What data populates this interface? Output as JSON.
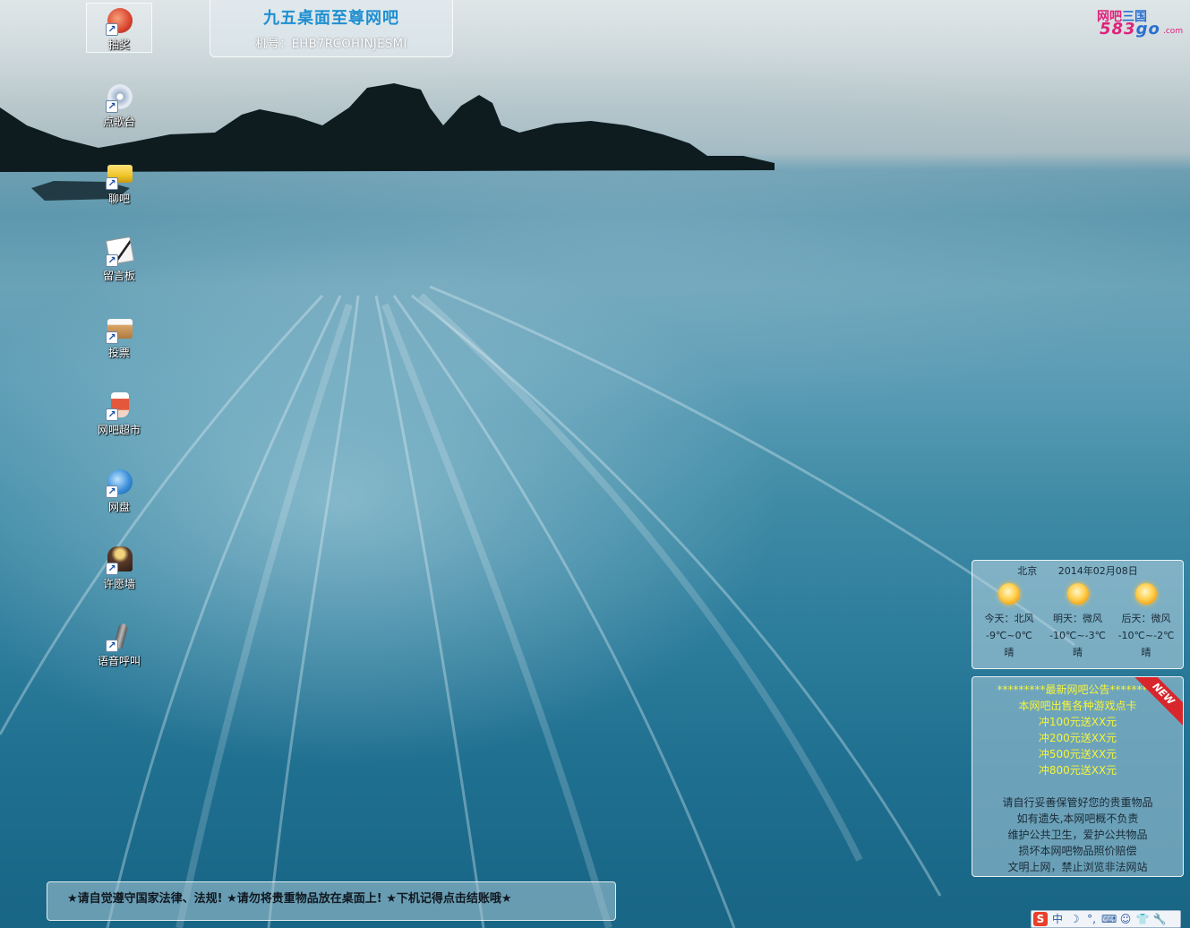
{
  "desktop": {
    "icons": [
      {
        "label": "抽奖",
        "icon": "lottery-icon",
        "color": "#d9442f",
        "selected": true
      },
      {
        "label": "点歌台",
        "icon": "music-cd-icon",
        "color": "#cfd8e6"
      },
      {
        "label": "聊吧",
        "icon": "chat-folder-icon",
        "color": "#f0c52a"
      },
      {
        "label": "留言板",
        "icon": "message-board-icon",
        "color": "#f2f2f2"
      },
      {
        "label": "投票",
        "icon": "vote-box-icon",
        "color": "#d8a66a"
      },
      {
        "label": "网吧超市",
        "icon": "supermarket-icon",
        "color": "#e3573a"
      },
      {
        "label": "网盘",
        "icon": "cloud-disk-icon",
        "color": "#3a8fd9"
      },
      {
        "label": "许愿墙",
        "icon": "wish-wall-icon",
        "color": "#5a3a2a"
      },
      {
        "label": "语音呼叫",
        "icon": "microphone-icon",
        "color": "#8a8a8a"
      }
    ]
  },
  "title_panel": {
    "title": "九五桌面至尊网吧",
    "machine": "机号：EHB7RCOHINJESMI"
  },
  "logo": {
    "top_a": "网吧",
    "top_b": "三国",
    "num_a": "583",
    "num_b": "go",
    "com": ".com"
  },
  "weather": {
    "city": "北京",
    "date": "2014年02月08日",
    "days": [
      {
        "wind": "今天：北风",
        "temp": "-9℃~0℃",
        "cond": "晴"
      },
      {
        "wind": "明天：微风",
        "temp": "-10℃~-3℃",
        "cond": "晴"
      },
      {
        "wind": "后天：微风",
        "temp": "-10℃~-2℃",
        "cond": "晴"
      }
    ]
  },
  "notice": {
    "badge": "NEW",
    "title": "*********最新网吧公告*********",
    "highlight_lines": [
      "本网吧出售各种游戏点卡",
      "冲100元送XX元",
      "冲200元送XX元",
      "冲500元送XX元",
      "冲800元送XX元"
    ],
    "rule_lines": [
      "请自行妥善保管好您的贵重物品",
      "如有遗失,本网吧概不负责",
      "维护公共卫生，爱护公共物品",
      "损坏本网吧物品照价赔偿",
      "文明上网，禁止浏览非法网站"
    ]
  },
  "marquee": {
    "text": "★请自觉遵守国家法律、法规! ★请勿将贵重物品放在桌面上! ★下机记得点击结账哦★"
  },
  "ime_toolbar": {
    "items": [
      {
        "glyph": "S",
        "icon": "sogou-logo-icon"
      },
      {
        "glyph": "中",
        "icon": "chinese-mode-icon"
      },
      {
        "glyph": "☽",
        "icon": "half-width-icon"
      },
      {
        "glyph": "°,",
        "icon": "punctuation-icon"
      },
      {
        "glyph": "⌨",
        "icon": "keyboard-icon"
      },
      {
        "glyph": "☺",
        "icon": "user-icon"
      },
      {
        "glyph": "👕",
        "icon": "skin-icon"
      },
      {
        "glyph": "🔧",
        "icon": "settings-wrench-icon"
      }
    ]
  }
}
